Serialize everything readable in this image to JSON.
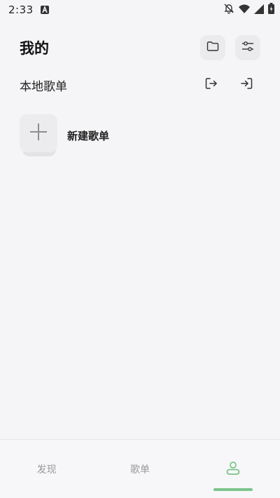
{
  "status_bar": {
    "time": "2:33",
    "icons": [
      "a-notification-icon",
      "bell-muted-icon",
      "wifi-icon",
      "signal-icon",
      "battery-icon"
    ]
  },
  "header": {
    "title": "我的",
    "actions": [
      "folder-icon",
      "sliders-icon"
    ]
  },
  "local_playlists": {
    "title": "本地歌单",
    "actions": [
      "export-icon",
      "import-icon"
    ]
  },
  "new_playlist": {
    "label": "新建歌单",
    "icon": "plus-icon"
  },
  "bottom_nav": {
    "items": [
      {
        "label": "发现"
      },
      {
        "label": "歌单"
      },
      {
        "label": "",
        "icon": "user-icon",
        "active": true
      }
    ],
    "accent": "#7dc48c"
  }
}
